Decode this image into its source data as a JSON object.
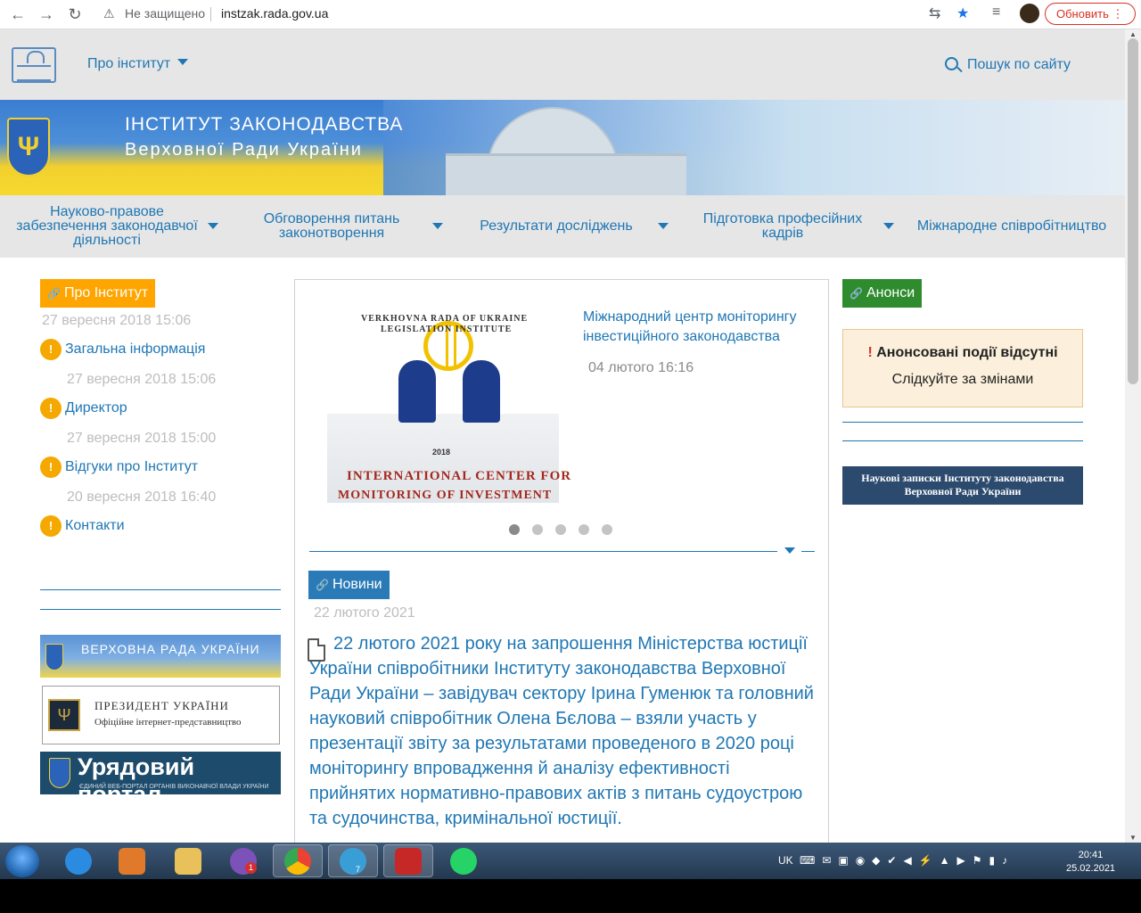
{
  "browser": {
    "security_label": "Не защищено",
    "url": "instzak.rada.gov.ua",
    "update_button": "Обновить"
  },
  "topbar": {
    "about_label": "Про інститут",
    "search_label": "Пошук по сайту"
  },
  "banner": {
    "title_line1": "ІНСТИТУТ ЗАКОНОДАВСТВА",
    "title_line2": "Верховної Ради України"
  },
  "mainnav": [
    {
      "label": "Науково-правове забезпечення законодавчої діяльності"
    },
    {
      "label": "Обговорення питань законотворення"
    },
    {
      "label": "Результати досліджень"
    },
    {
      "label": "Підготовка професійних кадрів"
    },
    {
      "label": "Міжнародне співробітництво"
    }
  ],
  "left": {
    "tag": "Про Інститут",
    "header_date": "27 вересня 2018 15:06",
    "items": [
      {
        "label": "Загальна інформація",
        "date": "27 вересня 2018 15:06"
      },
      {
        "label": "Директор",
        "date": "27 вересня 2018 15:00"
      },
      {
        "label": "Відгуки про Інститут",
        "date": "20 вересня 2018 16:40"
      },
      {
        "label": "Контакти"
      }
    ],
    "vru_banner": "ВЕРХОВНА РАДА УКРАЇНИ",
    "president_title": "ПРЕЗИДЕНТ УКРАЇНИ",
    "president_sub": "Офіційне інтернет-представництво",
    "gov_title": "Урядовий портал",
    "gov_sub": "ЄДИНИЙ ВЕБ-ПОРТАЛ ОРГАНІВ ВИКОНАВЧОЇ ВЛАДИ УКРАЇНИ"
  },
  "slider": {
    "img_line1": "VERKHOVNA RADA OF UKRAINE",
    "img_line2": "LEGISLATION INSTITUTE",
    "img_year": "2018",
    "img_bottom1": "INTERNATIONAL CENTER FOR",
    "img_bottom2": "MONITORING OF INVESTMENT",
    "title": "Міжнародний центр моніторингу інвестиційного законодавства",
    "date": "04 лютого 16:16",
    "slide_count": 5,
    "active_slide": 1
  },
  "news": {
    "tag": "Новини",
    "date": "22 лютого 2021",
    "body": "22 лютого 2021 року на запрошення Міністерства юстиції України співробітники Інституту законодавства Верховної Ради України – завідувач сектору Ірина Гуменюк та головний науковий співробітник Олена Бєлова – взяли участь у презентації звіту за результатами проведеного в 2020 році моніторингу впровадження й аналізу ефективності прийнятих нормативно-правових актів з питань судоустрою та судочинства, кримінальної юстиції."
  },
  "right": {
    "tag": "Анонси",
    "no_events_mark": "!",
    "no_events": "Анонсовані події відсутні",
    "follow": "Слідкуйте за змінами",
    "nauk_line1": "Наукові записки Інституту законодавства",
    "nauk_line2": "Верховної Ради України"
  },
  "taskbar": {
    "lang": "UK",
    "time": "20:41",
    "date": "25.02.2021",
    "viber_badge": "1",
    "telegram_badge": "7"
  },
  "colors": {
    "link": "#1f77b4",
    "about_tag": "#ffa500",
    "news_tag": "#2a7ab8",
    "announce_tag": "#2e8b2e"
  }
}
